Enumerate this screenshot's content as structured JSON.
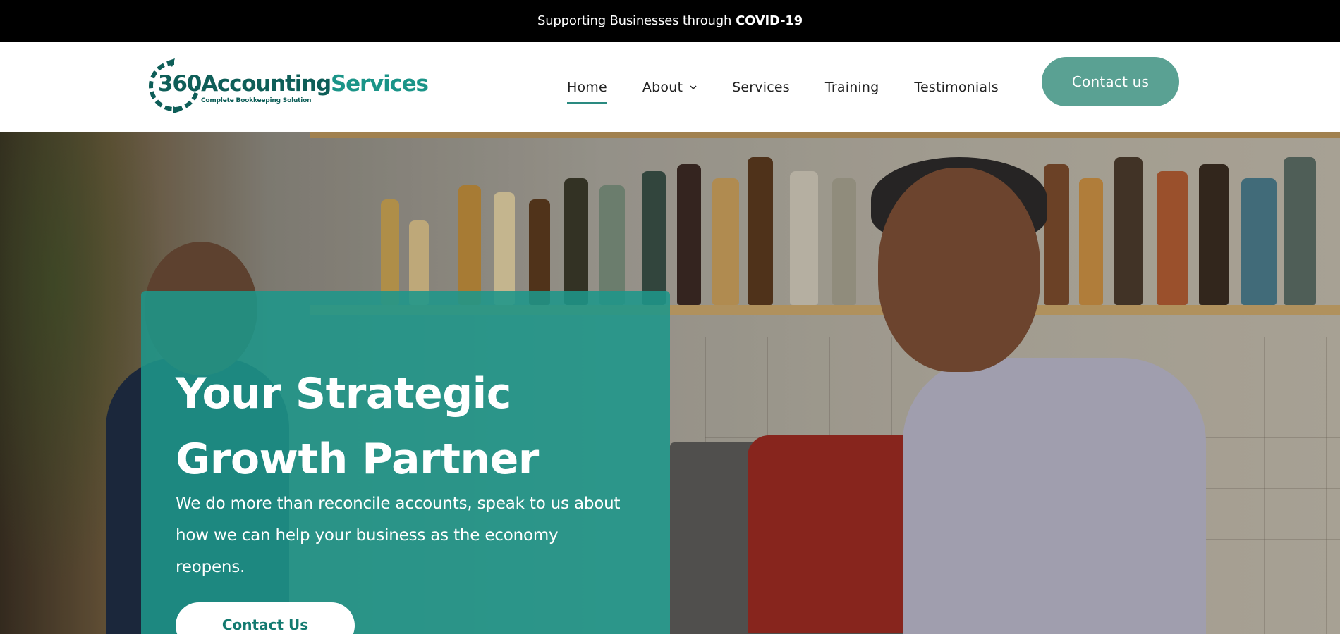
{
  "announcement": {
    "text": "Supporting Businesses through",
    "highlight": "COVID-19"
  },
  "logo": {
    "part1": "360",
    "part2": "Accounting",
    "part3": "Services",
    "tagline": "Complete Bookkeeping Solution"
  },
  "nav": {
    "items": [
      {
        "label": "Home",
        "active": true
      },
      {
        "label": "About",
        "has_dropdown": true
      },
      {
        "label": "Services"
      },
      {
        "label": "Training"
      },
      {
        "label": "Testimonials"
      }
    ],
    "cta_label": "Contact us"
  },
  "hero": {
    "title_line1": "Your Strategic",
    "title_line2": "Growth Partner",
    "subtitle": "We do more than reconcile accounts, speak to us about how we can help your business as the economy reopens.",
    "button_label": "Contact Us"
  },
  "colors": {
    "brand_dark": "#0e5e58",
    "brand": "#1a9488",
    "cta": "#5aa193",
    "hero_card": "#1e968a"
  }
}
